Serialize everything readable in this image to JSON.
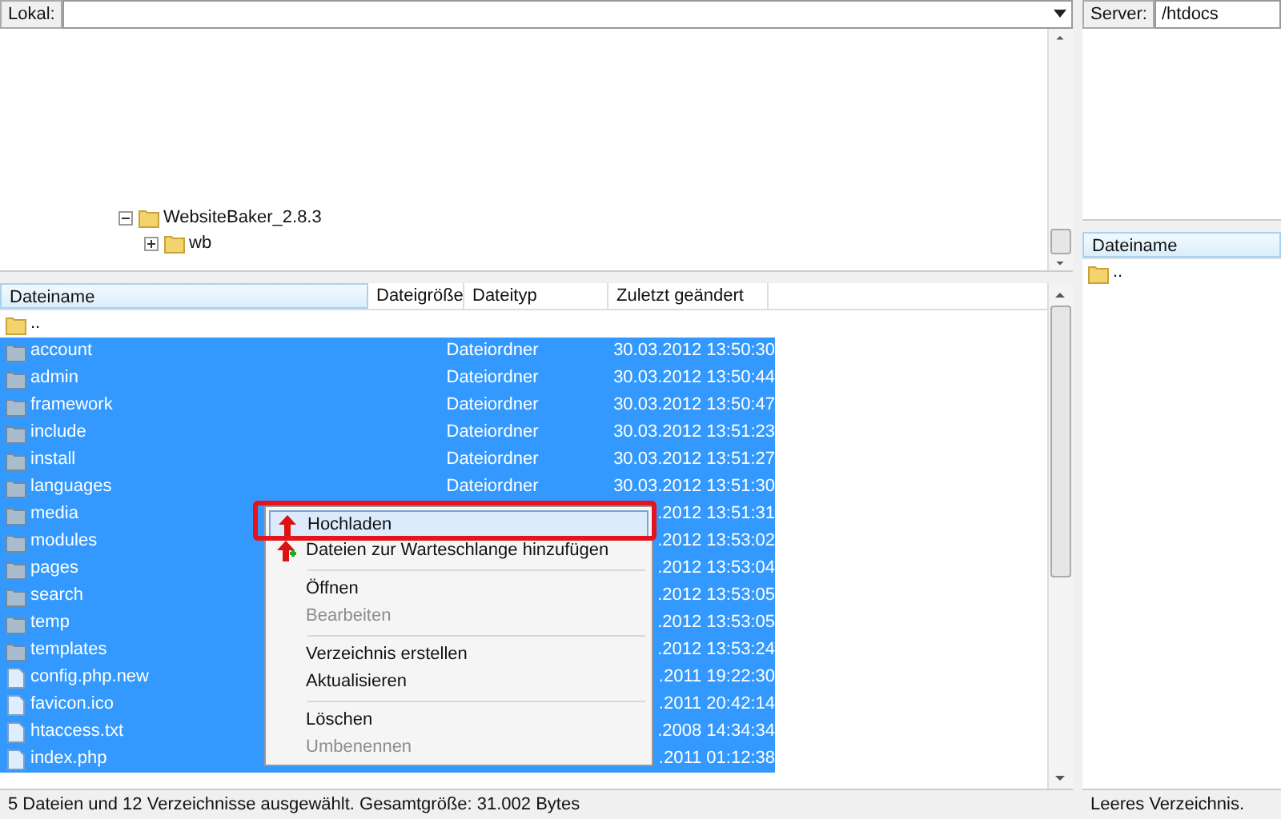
{
  "local": {
    "label": "Lokal:"
  },
  "server": {
    "label": "Server:",
    "path": "/htdocs"
  },
  "local_tree": [
    {
      "label": "WebsiteBaker_2.8.3",
      "expanded": true,
      "children": [
        {
          "label": "wb",
          "expanded": false
        }
      ]
    }
  ],
  "local_files": {
    "columns": [
      "Dateiname",
      "Dateigröße",
      "Dateityp",
      "Zuletzt geändert"
    ],
    "rows": [
      {
        "kind": "parent",
        "name": "..",
        "selected": false
      },
      {
        "kind": "folder",
        "name": "account",
        "type": "Dateiordner",
        "modified": "30.03.2012 13:50:30",
        "selected": true
      },
      {
        "kind": "folder",
        "name": "admin",
        "type": "Dateiordner",
        "modified": "30.03.2012 13:50:44",
        "selected": true
      },
      {
        "kind": "folder",
        "name": "framework",
        "type": "Dateiordner",
        "modified": "30.03.2012 13:50:47",
        "selected": true
      },
      {
        "kind": "folder",
        "name": "include",
        "type": "Dateiordner",
        "modified": "30.03.2012 13:51:23",
        "selected": true
      },
      {
        "kind": "folder",
        "name": "install",
        "type": "Dateiordner",
        "modified": "30.03.2012 13:51:27",
        "selected": true
      },
      {
        "kind": "folder",
        "name": "languages",
        "type": "Dateiordner",
        "modified": "30.03.2012 13:51:30",
        "selected": true
      },
      {
        "kind": "folder",
        "name": "media",
        "modified": ".2012 13:51:31",
        "selected": true
      },
      {
        "kind": "folder",
        "name": "modules",
        "modified": ".2012 13:53:02",
        "selected": true
      },
      {
        "kind": "folder",
        "name": "pages",
        "modified": ".2012 13:53:04",
        "selected": true
      },
      {
        "kind": "folder",
        "name": "search",
        "modified": ".2012 13:53:05",
        "selected": true
      },
      {
        "kind": "folder",
        "name": "temp",
        "modified": ".2012 13:53:05",
        "selected": true
      },
      {
        "kind": "folder",
        "name": "templates",
        "modified": ".2012 13:53:24",
        "selected": true
      },
      {
        "kind": "file",
        "name": "config.php.new",
        "modified": ".2011 19:22:30",
        "selected": true
      },
      {
        "kind": "file",
        "name": "favicon.ico",
        "modified": ".2011 20:42:14",
        "selected": true
      },
      {
        "kind": "file",
        "name": "htaccess.txt",
        "modified": ".2008 14:34:34",
        "selected": true
      },
      {
        "kind": "file",
        "name": "index.php",
        "modified": ".2011 01:12:38",
        "selected": true
      }
    ]
  },
  "context_menu": [
    {
      "kind": "item",
      "label": "Hochladen",
      "selected": true,
      "disabled": false
    },
    {
      "kind": "item",
      "label": "Dateien zur Warteschlange hinzufügen",
      "selected": false,
      "disabled": false
    },
    {
      "kind": "separator"
    },
    {
      "kind": "item",
      "label": "Öffnen",
      "selected": false,
      "disabled": false
    },
    {
      "kind": "item",
      "label": "Bearbeiten",
      "selected": false,
      "disabled": true
    },
    {
      "kind": "separator"
    },
    {
      "kind": "item",
      "label": "Verzeichnis erstellen",
      "selected": false,
      "disabled": false
    },
    {
      "kind": "item",
      "label": "Aktualisieren",
      "selected": false,
      "disabled": false
    },
    {
      "kind": "separator"
    },
    {
      "kind": "item",
      "label": "Löschen",
      "selected": false,
      "disabled": false
    },
    {
      "kind": "item",
      "label": "Umbenennen",
      "selected": false,
      "disabled": true
    }
  ],
  "server_files": {
    "columns": [
      "Dateiname"
    ],
    "rows": [
      {
        "kind": "parent",
        "name": "..",
        "selected": false
      }
    ]
  },
  "status_bar": {
    "local": "5 Dateien und 12 Verzeichnisse ausgewählt. Gesamtgröße: 31.002 Bytes",
    "server": "Leeres Verzeichnis."
  }
}
